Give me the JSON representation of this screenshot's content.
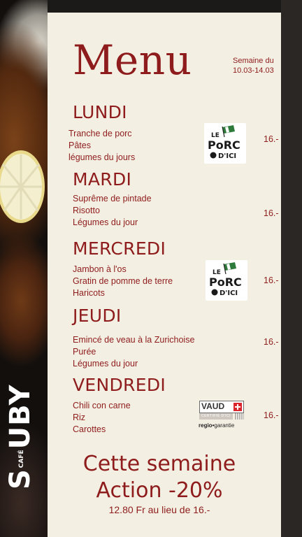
{
  "header": {
    "title": "Menu",
    "week_line1": "Semaine du",
    "week_line2": "10.03-14.03"
  },
  "days": [
    {
      "name": "LUNDI",
      "dishes": [
        "Tranche de porc",
        "Pâtes",
        "légumes du jours"
      ],
      "price": "16.-",
      "badge": "le-porc-d-ici"
    },
    {
      "name": "MARDI",
      "dishes": [
        "Suprême de pintade",
        "Risotto",
        "Légumes du jour"
      ],
      "price": "16.-",
      "badge": ""
    },
    {
      "name": "MERCREDI",
      "dishes": [
        "Jambon à l'os",
        "Gratin de pomme de terre",
        "Haricots"
      ],
      "price": "16.-",
      "badge": "le-porc-d-ici"
    },
    {
      "name": "JEUDI",
      "dishes": [
        "Emincé de veau à la Zurichoise",
        "Purée",
        "Légumes du jour"
      ],
      "price": "16.-",
      "badge": ""
    },
    {
      "name": "VENDREDI",
      "dishes": [
        "Chili con carne",
        "Riz",
        "Carottes"
      ],
      "price": "16.-",
      "badge": "vaud-regio-garantie"
    }
  ],
  "logos": {
    "porc_line1": "LE",
    "porc_line2": "PoRC",
    "porc_line3": "D'ICI",
    "vaud_name": "VAUD",
    "vaud_band": "CERTIFIÉ D'ICI",
    "vaud_regio": "regio",
    "vaud_garantie": "garantie"
  },
  "promo": {
    "line1": "Cette semaine",
    "line2": "Action -20%",
    "line3": "12.80 Fr au lieu de 16.-"
  },
  "brand": {
    "name_start": "S",
    "name_small": "CAFÉ",
    "name_end": "UBY"
  },
  "colors": {
    "accent": "#8e1c1c",
    "paper": "#f4efe3",
    "vaud_red": "#d8262c",
    "porc_green": "#2e7a3a"
  }
}
